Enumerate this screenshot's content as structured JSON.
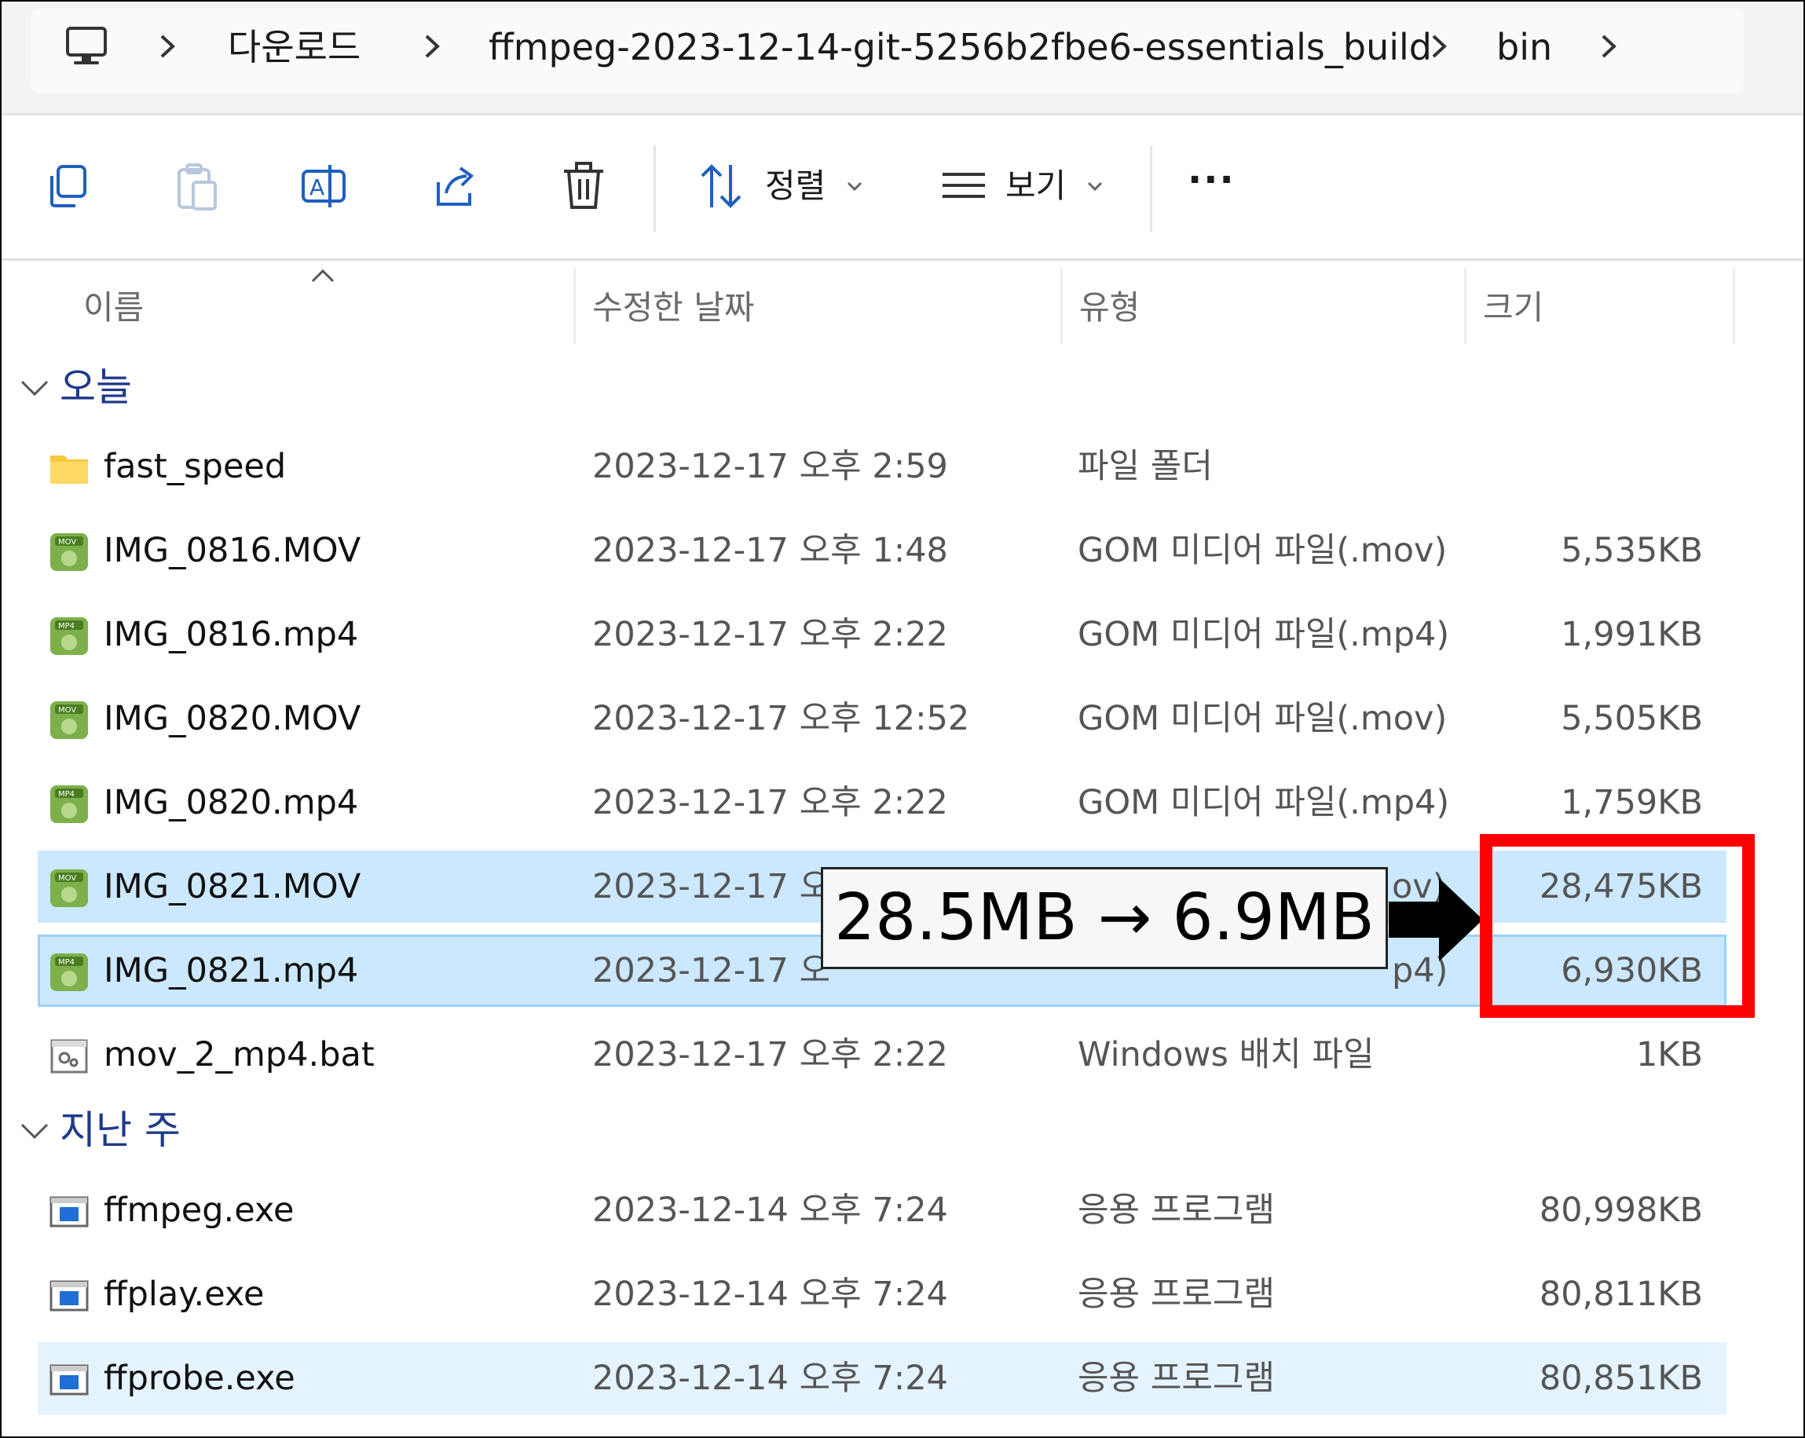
{
  "breadcrumb": {
    "items": [
      "다운로드",
      "ffmpeg-2023-12-14-git-5256b2fbe6-essentials_build",
      "bin"
    ]
  },
  "toolbar": {
    "sort_label": "정렬",
    "view_label": "보기",
    "more_label": "···"
  },
  "columns": {
    "name": "이름",
    "date": "수정한 날짜",
    "type": "유형",
    "size": "크기"
  },
  "groups": [
    {
      "label": "오늘",
      "files": [
        {
          "name": "fast_speed",
          "date": "2023-12-17 오후 2:59",
          "type": "파일 폴더",
          "size": "",
          "icon": "folder-icon"
        },
        {
          "name": "IMG_0816.MOV",
          "date": "2023-12-17 오후 1:48",
          "type": "GOM 미디어 파일(.mov)",
          "size": "5,535KB",
          "icon": "mov-file-icon"
        },
        {
          "name": "IMG_0816.mp4",
          "date": "2023-12-17 오후 2:22",
          "type": "GOM 미디어 파일(.mp4)",
          "size": "1,991KB",
          "icon": "mp4-file-icon"
        },
        {
          "name": "IMG_0820.MOV",
          "date": "2023-12-17 오후 12:52",
          "type": "GOM 미디어 파일(.mov)",
          "size": "5,505KB",
          "icon": "mov-file-icon"
        },
        {
          "name": "IMG_0820.mp4",
          "date": "2023-12-17 오후 2:22",
          "type": "GOM 미디어 파일(.mp4)",
          "size": "1,759KB",
          "icon": "mp4-file-icon"
        },
        {
          "name": "IMG_0821.MOV",
          "date": "2023-12-17 오",
          "type": "ov)",
          "size": "28,475KB",
          "icon": "mov-file-icon"
        },
        {
          "name": "IMG_0821.mp4",
          "date": "2023-12-17 오",
          "type": "p4)",
          "size": "6,930KB",
          "icon": "mp4-file-icon"
        },
        {
          "name": "mov_2_mp4.bat",
          "date": "2023-12-17 오후 2:22",
          "type": "Windows 배치 파일",
          "size": "1KB",
          "icon": "batch-file-icon"
        }
      ]
    },
    {
      "label": "지난 주",
      "files": [
        {
          "name": "ffmpeg.exe",
          "date": "2023-12-14 오후 7:24",
          "type": "응용 프로그램",
          "size": "80,998KB",
          "icon": "exe-file-icon"
        },
        {
          "name": "ffplay.exe",
          "date": "2023-12-14 오후 7:24",
          "type": "응용 프로그램",
          "size": "80,811KB",
          "icon": "exe-file-icon"
        },
        {
          "name": "ffprobe.exe",
          "date": "2023-12-14 오후 7:24",
          "type": "응용 프로그램",
          "size": "80,851KB",
          "icon": "exe-file-icon"
        }
      ]
    }
  ],
  "annotation": {
    "text": "28.5MB → 6.9MB",
    "highlight_color": "#ff0000"
  },
  "colors": {
    "selection": "#cce8ff",
    "group_label": "#1f3a8a"
  }
}
